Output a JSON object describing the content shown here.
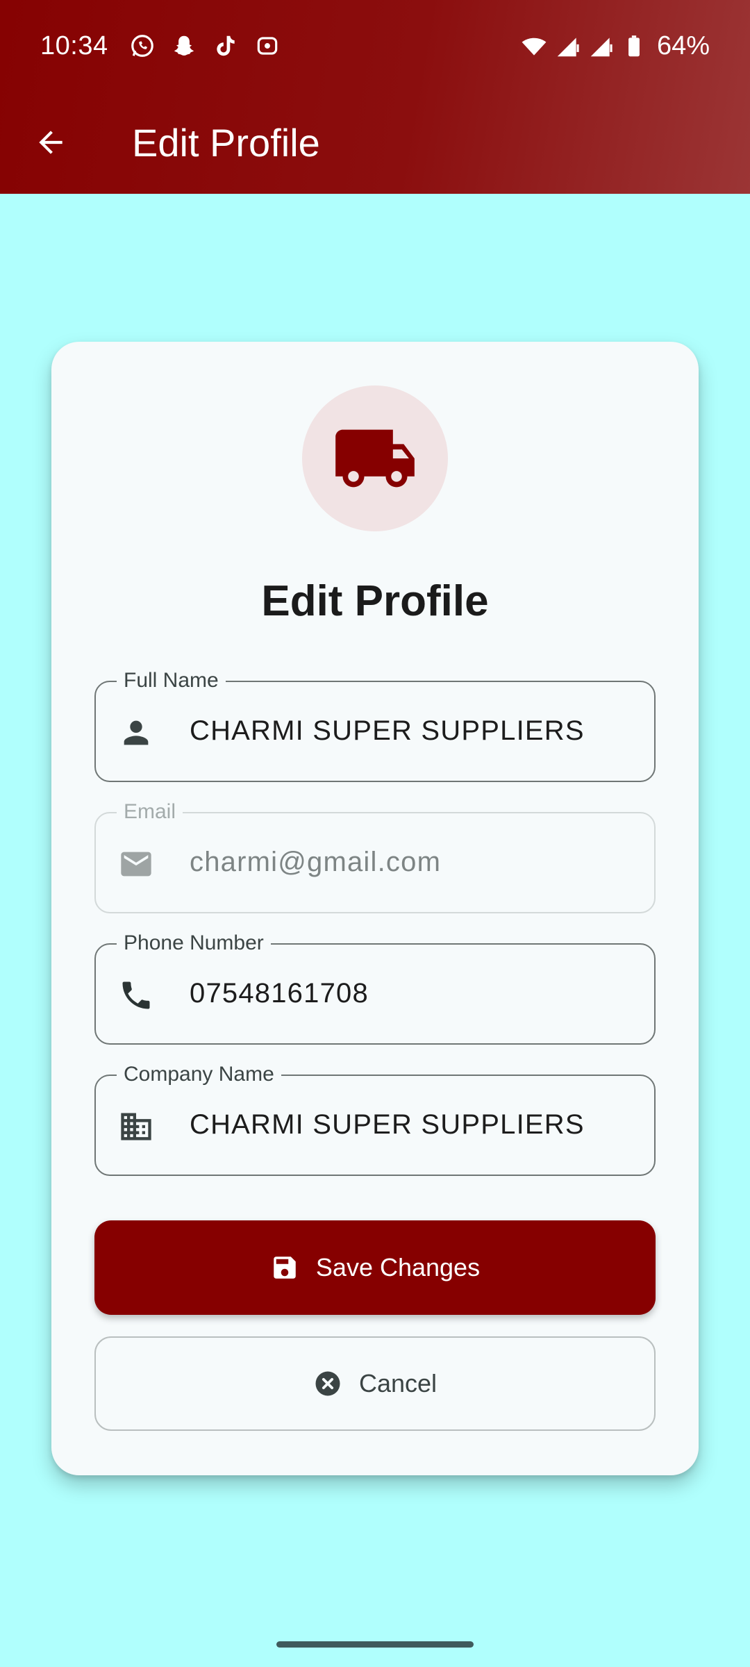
{
  "status_bar": {
    "time": "10:34",
    "notification_icons": [
      "whatsapp-icon",
      "snapchat-icon",
      "tiktok-icon",
      "media-icon"
    ],
    "battery": "64%"
  },
  "toolbar": {
    "title": "Edit Profile"
  },
  "card": {
    "avatar_icon": "truck-icon",
    "title": "Edit Profile"
  },
  "form": {
    "full_name": {
      "label": "Full Name",
      "value": "CHARMI SUPER SUPPLIERS",
      "icon": "person-icon"
    },
    "email": {
      "label": "Email",
      "value": "charmi@gmail.com",
      "icon": "mail-icon",
      "disabled": true
    },
    "phone": {
      "label": "Phone Number",
      "value": "07548161708",
      "icon": "phone-icon"
    },
    "company": {
      "label": "Company Name",
      "value": "CHARMI SUPER SUPPLIERS",
      "icon": "business-icon"
    }
  },
  "actions": {
    "save_label": "Save Changes",
    "cancel_label": "Cancel"
  },
  "colors": {
    "primary": "#860000",
    "background": "#b0fffd",
    "card": "#f6fafb",
    "avatar_bg": "#f1e3e4"
  }
}
